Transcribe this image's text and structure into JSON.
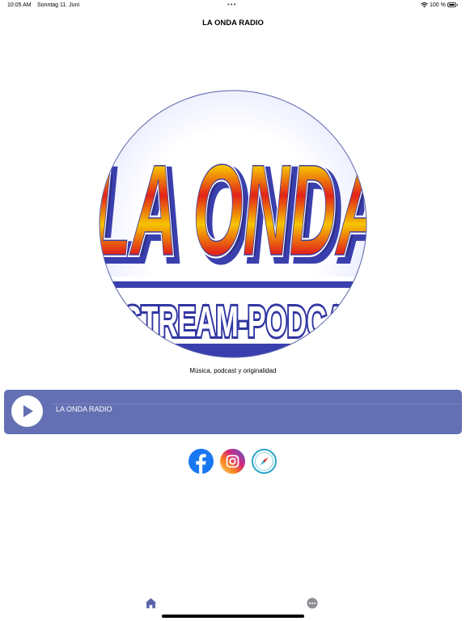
{
  "status_bar": {
    "time": "10:05 AM",
    "date": "Sonntag 11. Juni",
    "dots": "•••",
    "battery": "100 %"
  },
  "app": {
    "title": "LA ONDA RADIO",
    "tagline": "Música, podcast y originalidad"
  },
  "logo": {
    "line1": "LA ONDA",
    "line2": "STREAM-PODCAST"
  },
  "player": {
    "station": "LA ONDA RADIO",
    "state": "paused"
  },
  "social": {
    "icons": [
      "facebook-icon",
      "instagram-icon",
      "compass-icon"
    ]
  },
  "tab_bar": {
    "icons": [
      "home-icon",
      "more-icon"
    ]
  },
  "colors": {
    "player_bg": "#6470b3",
    "accent": "#5a63a8",
    "facebook": "#1877f2",
    "web": "#2ba6c8"
  }
}
